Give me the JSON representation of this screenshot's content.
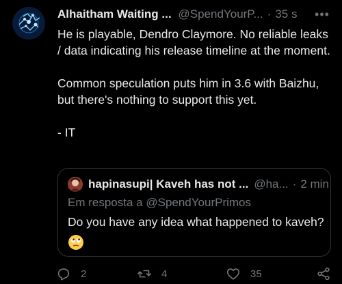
{
  "tweet": {
    "display_name": "Alhaitham Waiting ...",
    "handle": "@SpendYourP...",
    "separator": "·",
    "time": "35 s",
    "more_label": "•••",
    "paragraphs": [
      "He is playable, Dendro Claymore. No reliable leaks / data indicating his release timeline at the moment.",
      "Common speculation puts him in 3.6 with Baizhu, but there's nothing to support this yet.",
      "- IT"
    ]
  },
  "quote": {
    "display_name": "hapinasupi| Kaveh has not ...",
    "handle": "@ha...",
    "separator": "·",
    "time": "2 min",
    "reply_prefix": "Em resposta a",
    "reply_mention": "@SpendYourPrimos",
    "text": "Do you have any idea what happened to kaveh?",
    "emoji": "face-with-rolling-eyes"
  },
  "actions": {
    "reply_count": "2",
    "retweet_count": "4",
    "like_count": "35"
  },
  "colors": {
    "background": "#000000",
    "text_primary": "#e7e9ea",
    "text_secondary": "#71767b",
    "border": "#2f3336"
  },
  "icons": [
    "avatar-icon",
    "more-icon",
    "reply-icon",
    "retweet-icon",
    "like-icon",
    "share-icon",
    "rolling-eyes-emoji"
  ]
}
